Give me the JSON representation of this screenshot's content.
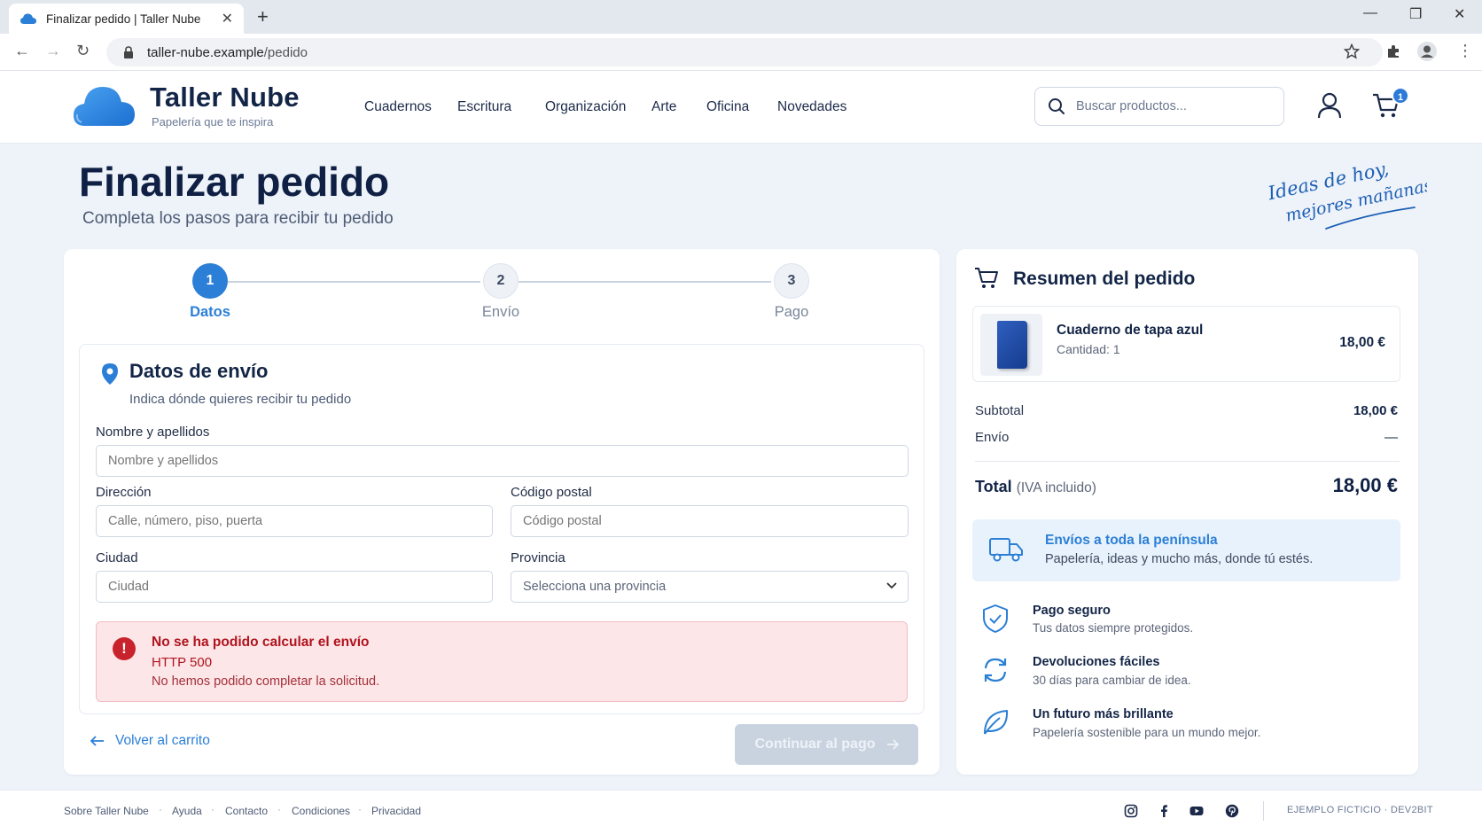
{
  "browser": {
    "tab_title": "Finalizar pedido | Taller Nube",
    "url_domain": "taller-nube.example",
    "url_path": "/pedido"
  },
  "header": {
    "brand_name": "Taller Nube",
    "brand_tagline": "Papelería que te inspira",
    "nav": [
      "Cuadernos",
      "Escritura",
      "Organización",
      "Arte",
      "Oficina",
      "Novedades"
    ],
    "search_placeholder": "Buscar productos...",
    "cart_count": "1"
  },
  "page": {
    "title": "Finalizar pedido",
    "subtitle": "Completa los pasos para recibir tu pedido",
    "slogan_line1": "Ideas de hoy,",
    "slogan_line2": "mejores mañanas"
  },
  "steps": [
    {
      "number": "1",
      "label": "Datos",
      "state": "active"
    },
    {
      "number": "2",
      "label": "Envío",
      "state": "inactive"
    },
    {
      "number": "3",
      "label": "Pago",
      "state": "inactive"
    }
  ],
  "form": {
    "title": "Datos de envío",
    "subtitle": "Indica dónde quieres recibir tu pedido",
    "name_label": "Nombre y apellidos",
    "name_placeholder": "Nombre y apellidos",
    "address_label": "Dirección",
    "address_placeholder": "Calle, número, piso, puerta",
    "postal_label": "Código postal",
    "postal_placeholder": "Código postal",
    "city_label": "Ciudad",
    "city_placeholder": "Ciudad",
    "province_label": "Provincia",
    "province_value": "Selecciona una provincia"
  },
  "alert": {
    "title": "No se ha podido calcular el envío",
    "code": "HTTP 500",
    "message": "No hemos podido completar la solicitud."
  },
  "actions": {
    "back_label": "Volver al carrito",
    "continue_label": "Continuar al pago"
  },
  "summary": {
    "title": "Resumen del pedido",
    "item_name": "Cuaderno de tapa azul",
    "item_qty": "Cantidad: 1",
    "item_price": "18,00 €",
    "subtotal_label": "Subtotal",
    "subtotal_value": "18,00 €",
    "shipping_label": "Envío",
    "shipping_value": "—",
    "total_label": "Total",
    "total_note": "(IVA incluido)",
    "total_value": "18,00 €",
    "shipping_box_title": "Envíos a toda la península",
    "shipping_box_sub": "Papelería, ideas y mucho más, donde tú estés.",
    "features": [
      {
        "title": "Pago seguro",
        "sub": "Tus datos siempre protegidos."
      },
      {
        "title": "Devoluciones fáciles",
        "sub": "30 días para cambiar de idea."
      },
      {
        "title": "Un futuro más brillante",
        "sub": "Papelería sostenible para un mundo mejor."
      }
    ]
  },
  "footer": {
    "links": [
      "Sobre Taller Nube",
      "Ayuda",
      "Contacto",
      "Condiciones",
      "Privacidad"
    ],
    "note": "EJEMPLO FICTICIO · DEV2BIT"
  },
  "colors": {
    "accent": "#2b7fd6",
    "navy": "#132547",
    "error": "#c8232c",
    "error_bg": "#fde6e8"
  }
}
